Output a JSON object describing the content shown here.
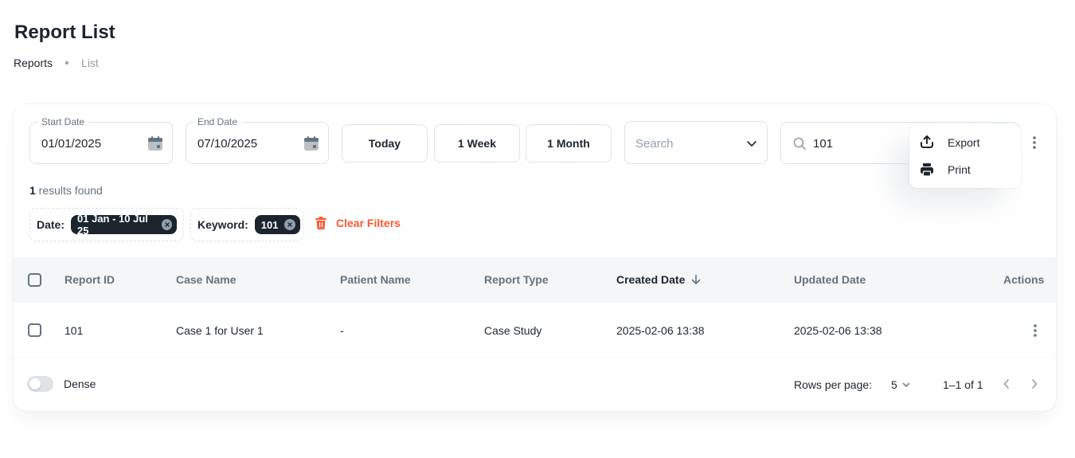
{
  "page": {
    "title": "Report List",
    "breadcrumb": {
      "link": "Reports",
      "current": "List"
    }
  },
  "filters": {
    "start_date": {
      "label": "Start Date",
      "value": "01/01/2025"
    },
    "end_date": {
      "label": "End Date",
      "value": "07/10/2025"
    },
    "range_buttons": [
      "Today",
      "1 Week",
      "1 Month"
    ],
    "type_select": {
      "placeholder": "Search"
    },
    "search": {
      "value": "101"
    }
  },
  "menu": {
    "items": [
      {
        "label": "Export",
        "icon": "export-icon"
      },
      {
        "label": "Print",
        "icon": "printer-icon"
      }
    ]
  },
  "results": {
    "count": "1",
    "text": " results found"
  },
  "active_filters": {
    "date": {
      "label": "Date:",
      "chip": "01 Jan - 10 Jul 25"
    },
    "keyword": {
      "label": "Keyword:",
      "chip": "101"
    },
    "clear_label": "Clear Filters"
  },
  "table": {
    "headers": [
      "Report ID",
      "Case Name",
      "Patient Name",
      "Report Type",
      "Created Date",
      "Updated Date",
      "Actions"
    ],
    "sorted_column": "Created Date",
    "sort_direction": "desc",
    "rows": [
      [
        "101",
        "Case 1 for User 1",
        "-",
        "Case Study",
        "2025-02-06 13:38",
        "2025-02-06 13:38"
      ]
    ]
  },
  "footer": {
    "dense_label": "Dense",
    "dense_on": false,
    "rows_per_page_label": "Rows per page:",
    "rows_per_page": "5",
    "page_range": "1–1 of 1"
  },
  "colors": {
    "accent_danger": "#ff5630",
    "chip_bg": "#1c252e",
    "muted_text": "#637381",
    "header_bg": "#f4f6f8"
  }
}
